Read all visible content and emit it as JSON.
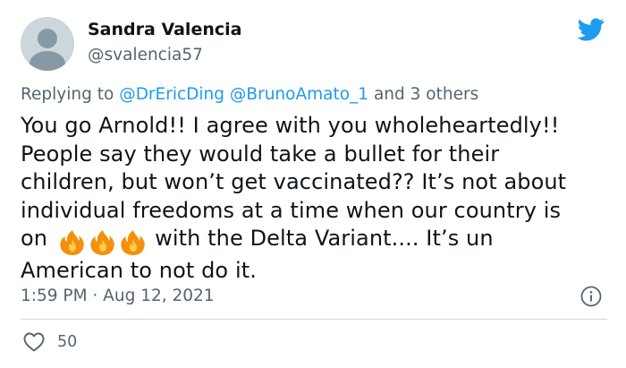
{
  "author": {
    "display_name": "Sandra Valencia",
    "handle": "@svalencia57"
  },
  "reply": {
    "prefix": "Replying to ",
    "mention_1": "@DrEricDing",
    "mention_2": "@BrunoAmato_1",
    "suffix": " and 3 others"
  },
  "body": {
    "line_1": "You go Arnold!! I agree with you wholeheartedly!!",
    "line_2": "People say they would take a bullet for their",
    "line_3": "children, but won’t get vaccinated?? It’s not about",
    "line_4": "individual freedoms at a time when our country is",
    "line_5_pre": "on",
    "line_5_post": "with the Delta Variant.... It’s un",
    "line_6": "American to not do it.",
    "emoji": "fire-icon",
    "emoji_count": 3
  },
  "meta": {
    "timestamp": "1:59 PM · Aug 12, 2021"
  },
  "engagement": {
    "likes": "50"
  },
  "colors": {
    "accent": "#1d9bf0",
    "secondary_text": "#536471",
    "primary_text": "#0f1419",
    "divider": "#cfd9de",
    "avatar_bg": "#ccd6dd"
  },
  "icons": {
    "brand": "twitter-bird-icon",
    "info": "info-icon",
    "like": "heart-outline-icon",
    "avatar": "default-avatar-icon"
  }
}
